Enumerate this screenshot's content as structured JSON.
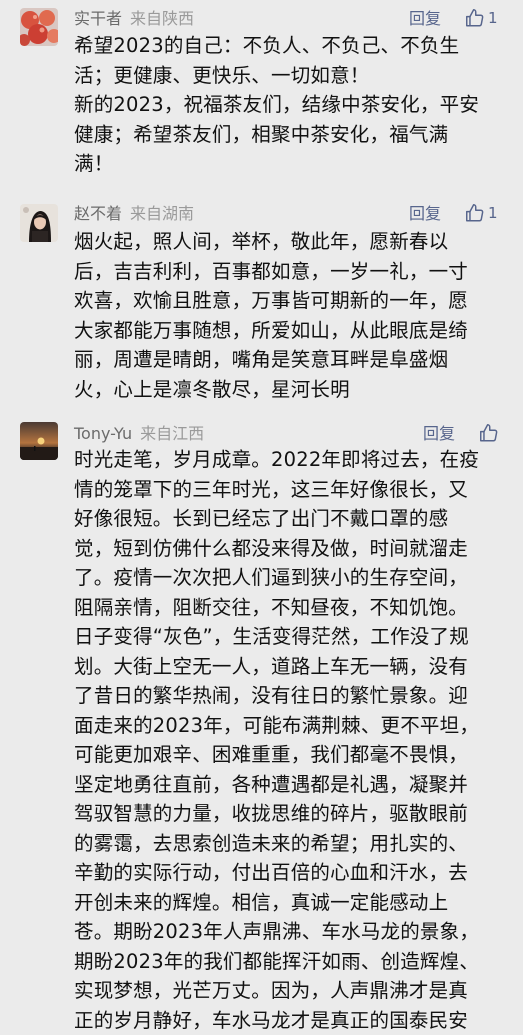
{
  "actions": {
    "reply_label": "回复"
  },
  "comments": [
    {
      "author": "实干者",
      "location": "来自陕西",
      "likes": "1",
      "lines": [
        "希望2023的自己：不负人、不负己、不负生",
        "活；更健康、更快乐、一切如意！",
        "新的2023，祝福茶友们，结缘中茶安化，平安",
        "健康；希望茶友们，相聚中茶安化，福气满",
        "满！"
      ]
    },
    {
      "author": "赵不着",
      "location": "来自湖南",
      "likes": "1",
      "lines": [
        "烟火起，照人间，举杯，敬此年，愿新春以",
        "后，吉吉利利，百事都如意，一岁一礼，一寸",
        "欢喜，欢愉且胜意，万事皆可期新的一年，愿",
        "大家都能万事随想，所爱如山，从此眼底是绮",
        "丽，周遭是晴朗，嘴角是笑意耳畔是阜盛烟",
        "火，心上是凛冬散尽，星河长明"
      ]
    },
    {
      "author": "Tony-Yu",
      "location": "来自江西",
      "likes": "",
      "lines": [
        "时光走笔，岁月成章。2022年即将过去，在疫",
        "情的笼罩下的三年时光，这三年好像很长，又",
        "好像很短。长到已经忘了出门不戴口罩的感",
        "觉，短到仿佛什么都没来得及做，时间就溜走",
        "了。疫情一次次把人们逼到狭小的生存空间，",
        "阻隔亲情，阻断交往，不知昼夜，不知饥饱。",
        "日子变得“灰色”，生活变得茫然，工作没了规",
        "划。大街上空无一人，道路上车无一辆，没有",
        "了昔日的繁华热闹，没有往日的繁忙景象。迎",
        "面走来的2023年，可能布满荆棘、更不平坦，",
        "可能更加艰辛、困难重重，我们都毫不畏惧，",
        "坚定地勇往直前，各种遭遇都是礼遇，凝聚并",
        "驾驭智慧的力量，收拢思维的碎片，驱散眼前",
        "的雾霭，去思索创造未来的希望；用扎实的、",
        "辛勤的实际行动，付出百倍的心血和汗水，去",
        "开创未来的辉煌。相信，真诚一定能感动上",
        "苍。期盼2023年人声鼎沸、车水马龙的景象，",
        "期盼2023年的我们都能挥汗如雨、创造辉煌、",
        "实现梦想，光芒万丈。因为，人声鼎沸才是真",
        "正的岁月静好，车水马龙才是真正的国泰民安"
      ]
    }
  ]
}
